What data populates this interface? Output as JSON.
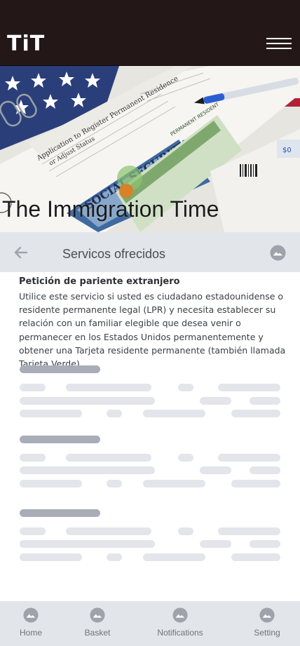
{
  "header": {
    "logo_text": "TiT",
    "menu_icon": "hamburger-menu-icon",
    "background_color": "#231817"
  },
  "hero": {
    "title": "The Immigration Time"
  },
  "section": {
    "title": "Servicos ofrecidos",
    "back_icon": "back-arrow-icon",
    "image_icon": "image-icon"
  },
  "content": {
    "title": "Petición de pariente extranjero",
    "body": "Utilice este servicio si usted es ciudadano estadounidense o residente permanente legal (LPR) y necesita establecer su relación con un familiar elegible que desea venir o permanecer en los Estados Unidos permanentemente y obtener una Tarjeta residente permanente (también llamada Tarjeta Verde)."
  },
  "bottom_nav": {
    "items": [
      {
        "label": "Home",
        "icon": "image-icon"
      },
      {
        "label": "Basket",
        "icon": "image-icon"
      },
      {
        "label": "Notifications",
        "icon": "image-icon"
      },
      {
        "label": "Setting",
        "icon": "image-icon"
      }
    ]
  },
  "colors": {
    "section_bg": "#e2e5ea",
    "skeleton_heading": "#a8adb7",
    "skeleton_line": "#e3e5ea",
    "icon_gray": "#9ea3ab"
  }
}
